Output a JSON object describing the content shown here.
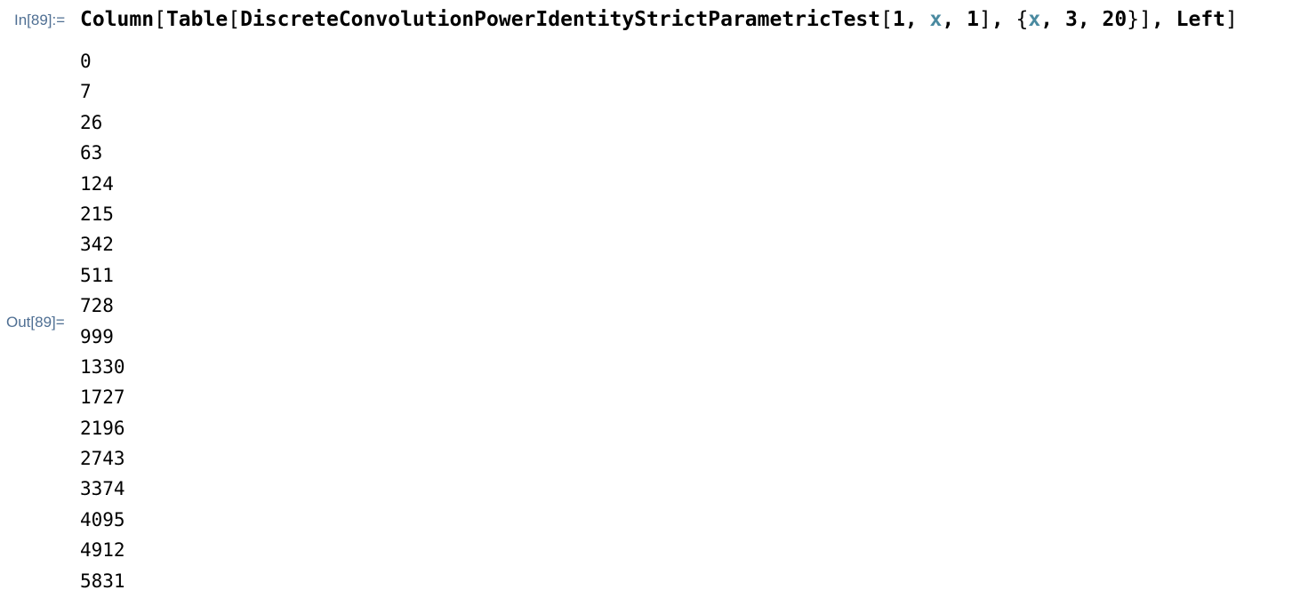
{
  "input_cell": {
    "label": "In[89]:=",
    "tokens": [
      {
        "text": "Column",
        "role": "kw"
      },
      {
        "text": "[",
        "role": "brk"
      },
      {
        "text": "Table",
        "role": "kw"
      },
      {
        "text": "[",
        "role": "brk"
      },
      {
        "text": "DiscreteConvolutionPowerIdentityStrictParametricTest",
        "role": "kw"
      },
      {
        "text": "[",
        "role": "brk"
      },
      {
        "text": "1",
        "role": "num"
      },
      {
        "text": ", ",
        "role": "kw"
      },
      {
        "text": "x",
        "role": "var"
      },
      {
        "text": ", ",
        "role": "kw"
      },
      {
        "text": "1",
        "role": "num"
      },
      {
        "text": "]",
        "role": "brk"
      },
      {
        "text": ", ",
        "role": "kw"
      },
      {
        "text": "{",
        "role": "brk"
      },
      {
        "text": "x",
        "role": "var"
      },
      {
        "text": ", ",
        "role": "kw"
      },
      {
        "text": "3",
        "role": "num"
      },
      {
        "text": ", ",
        "role": "kw"
      },
      {
        "text": "20",
        "role": "num"
      },
      {
        "text": "}",
        "role": "brk"
      },
      {
        "text": "]",
        "role": "brk"
      },
      {
        "text": ", ",
        "role": "kw"
      },
      {
        "text": "Left",
        "role": "kw"
      },
      {
        "text": "]",
        "role": "brk"
      }
    ]
  },
  "output_cell": {
    "label": "Out[89]=",
    "values": [
      "0",
      "7",
      "26",
      "63",
      "124",
      "215",
      "342",
      "511",
      "728",
      "999",
      "1330",
      "1727",
      "2196",
      "2743",
      "3374",
      "4095",
      "4912",
      "5831"
    ]
  },
  "colors": {
    "label": "#4f6f93",
    "variable": "#4a8aa0",
    "text": "#000000",
    "background": "#ffffff"
  }
}
